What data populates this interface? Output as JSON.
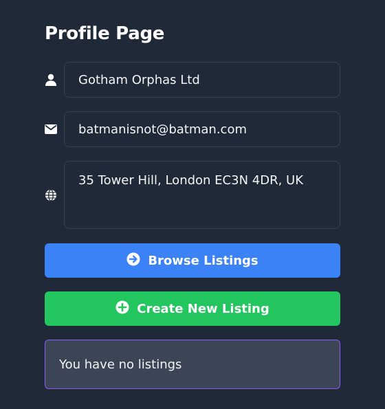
{
  "page": {
    "title": "Profile Page"
  },
  "profile": {
    "name_value": "Gotham Orphas Ltd",
    "email_value": "batmanisnot@batman.com",
    "address_value": "35 Tower Hill, London EC3N 4DR, UK"
  },
  "icons": {
    "name": "user-icon",
    "email": "envelope-icon",
    "address": "globe-icon",
    "browse": "arrow-circle-right-icon",
    "create": "plus-circle-icon"
  },
  "actions": {
    "browse_label": "Browse Listings",
    "create_label": "Create New Listing"
  },
  "listings": {
    "empty_message": "You have no listings"
  },
  "colors": {
    "background": "#1f2937",
    "browse_button": "#3b82f6",
    "create_button": "#22c55e",
    "notice_border": "#8b5cf6"
  }
}
